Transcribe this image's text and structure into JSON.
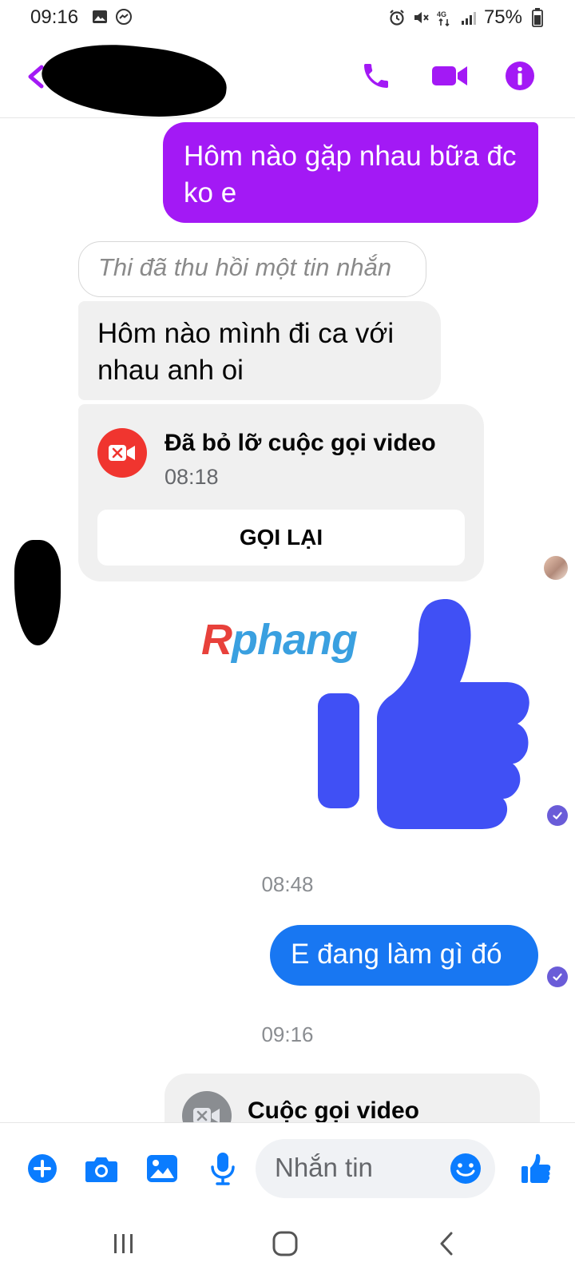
{
  "status_bar": {
    "time": "09:16",
    "network": "4G",
    "battery": "75%"
  },
  "header": {
    "icons": [
      "back-arrow-icon",
      "phone-icon",
      "video-camera-icon",
      "info-icon"
    ]
  },
  "messages": {
    "outgoing_1": "Hôm nào gặp nhau bữa đc ko e",
    "unsent_notice": "Thi đã thu hồi một tin nhắn",
    "incoming_1": "Hôm nào mình đi ca với nhau anh oi",
    "missed_call": {
      "title": "Đã bỏ lỡ cuộc gọi video",
      "time": "08:18",
      "callback_label": "GỌI LẠI"
    },
    "watermark_r": "R",
    "watermark_rest": "phang",
    "timestamp_1": "08:48",
    "outgoing_2": "E đang làm gì đó",
    "timestamp_2": "09:16",
    "video_call": {
      "title": "Cuộc gọi video"
    }
  },
  "composer": {
    "placeholder": "Nhắn tin"
  },
  "colors": {
    "accent": "#a319f5",
    "outgoing_blue": "#1877f2",
    "thumb": "#4050f5",
    "missed_call_red": "#f0352f",
    "messenger_blue": "#0a7cff"
  }
}
